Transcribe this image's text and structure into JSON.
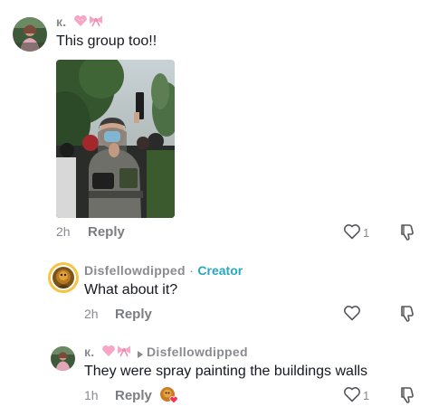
{
  "comments": [
    {
      "username": "к.",
      "text": "This group too!!",
      "time": "2h",
      "reply_label": "Reply",
      "like_count": "1",
      "has_photo": true
    }
  ],
  "replies": [
    {
      "username": "Disfellowdipped",
      "separator": "·",
      "badge": "Creator",
      "text": "What about it?",
      "time": "2h",
      "reply_label": "Reply",
      "like_count": ""
    },
    {
      "username": "к.",
      "reply_to": "Disfellowdipped",
      "text": "They were spray painting the buildings walls",
      "time": "1h",
      "reply_label": "Reply",
      "like_count": "1"
    }
  ],
  "icons": {
    "heart": "heart-outline-icon",
    "dislike": "thumbs-down-icon",
    "bow": "pink-bow-icon",
    "pink_heart": "pink-heart-icon",
    "reply_arrow": "reply-arrow-icon",
    "creator_liked": "creator-liked-icon"
  },
  "colors": {
    "username": "#8a8b91",
    "creator_badge": "#25a7c4",
    "text": "#161823",
    "pink": "#f7a6c6",
    "creator_ring": "#f6c445"
  }
}
